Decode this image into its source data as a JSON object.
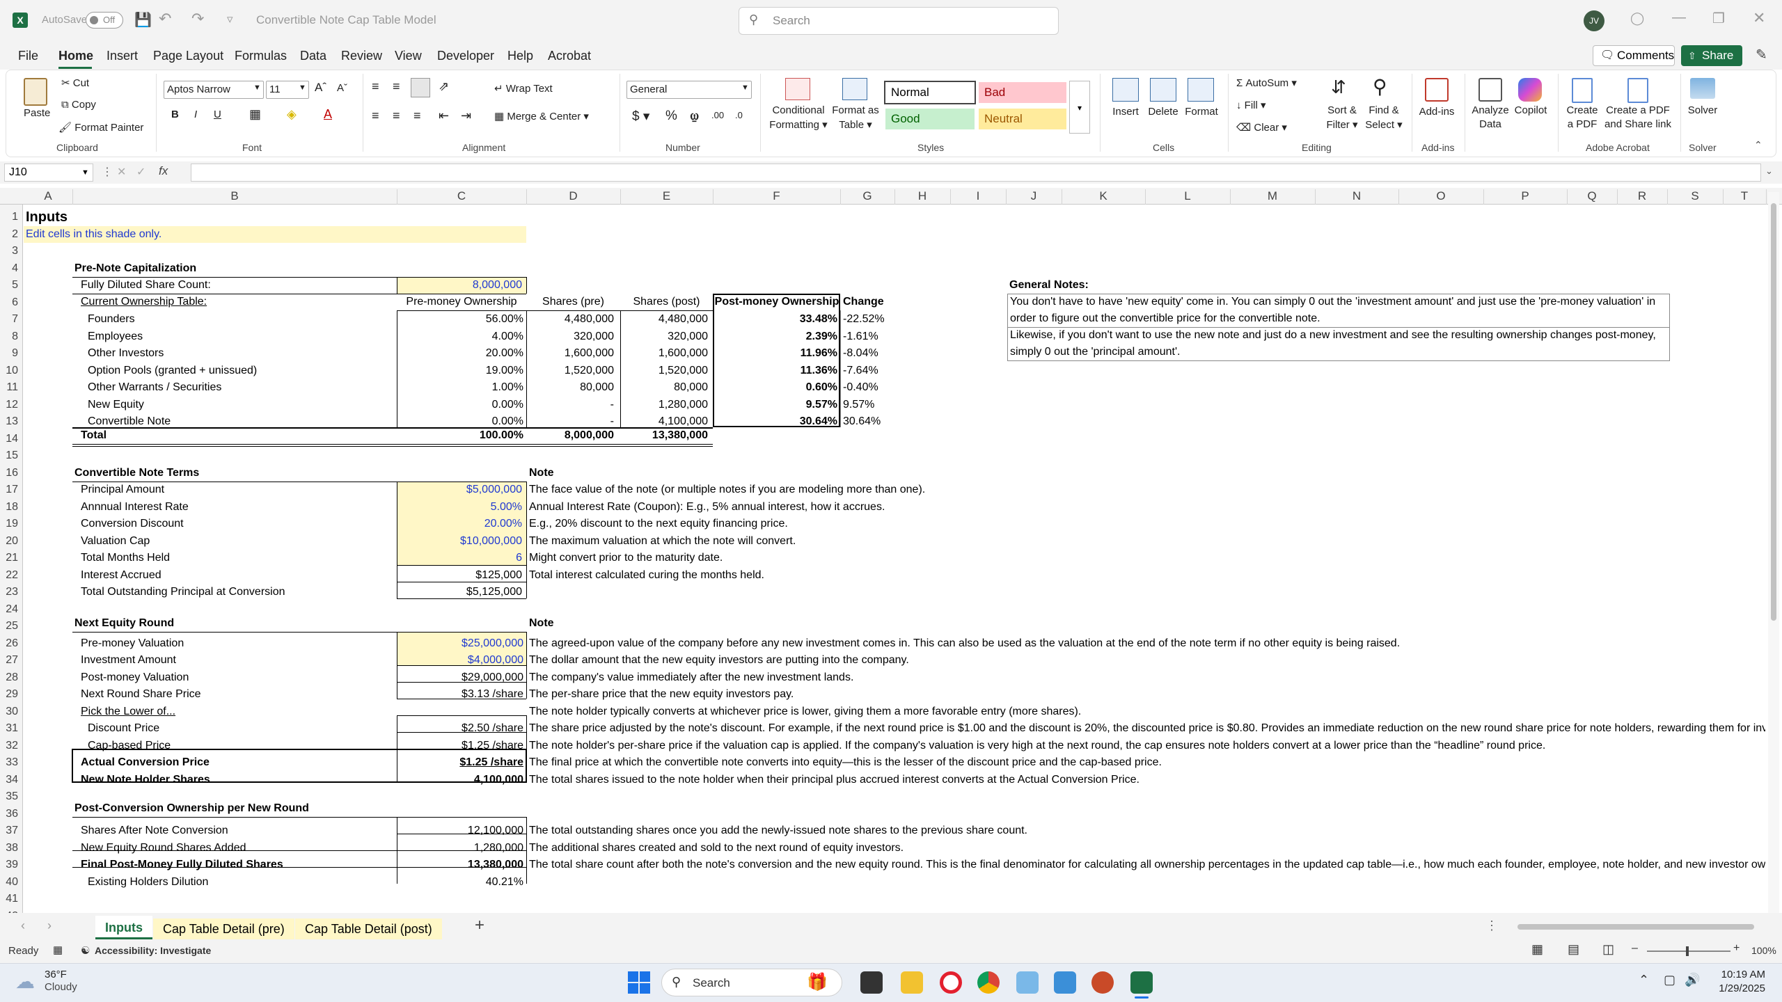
{
  "titlebar": {
    "autosave": "AutoSave",
    "autosave_state": "Off",
    "doc_title": "Convertible Note Cap Table Model",
    "search_placeholder": "Search",
    "avatar": "JV"
  },
  "menu": [
    "File",
    "Home",
    "Insert",
    "Page Layout",
    "Formulas",
    "Data",
    "Review",
    "View",
    "Developer",
    "Help",
    "Acrobat"
  ],
  "actions": {
    "comments": "Comments",
    "share": "Share"
  },
  "ribbon": {
    "clipboard": {
      "paste": "Paste",
      "cut": "Cut",
      "copy": "Copy",
      "format_painter": "Format Painter",
      "label": "Clipboard"
    },
    "font": {
      "name": "Aptos Narrow",
      "size": "11",
      "label": "Font"
    },
    "alignment": {
      "wrap": "Wrap Text",
      "merge": "Merge & Center",
      "label": "Alignment"
    },
    "number": {
      "format": "General",
      "label": "Number"
    },
    "styles": {
      "conditional": "Conditional",
      "conditional2": "Formatting",
      "format_table": "Format as",
      "format_table2": "Table",
      "normal": "Normal",
      "bad": "Bad",
      "good": "Good",
      "neutral": "Neutral",
      "label": "Styles"
    },
    "cells": {
      "insert": "Insert",
      "delete": "Delete",
      "format": "Format",
      "label": "Cells"
    },
    "editing": {
      "autosum": "AutoSum",
      "fill": "Fill",
      "clear": "Clear",
      "sort": "Sort &",
      "sort2": "Filter",
      "find": "Find &",
      "find2": "Select",
      "label": "Editing"
    },
    "addins": {
      "addins": "Add-ins",
      "label": "Add-ins",
      "analyze": "Analyze",
      "analyze2": "Data",
      "copilot": "Copilot"
    },
    "acrobat": {
      "create": "Create",
      "create2": "a PDF",
      "create_share": "Create a PDF",
      "create_share2": "and Share link",
      "label": "Adobe Acrobat"
    },
    "solver": {
      "solver": "Solver",
      "label": "Solver"
    }
  },
  "formula_bar": {
    "namebox": "J10",
    "fx": "fx",
    "formula": ""
  },
  "columns": [
    "A",
    "B",
    "C",
    "D",
    "E",
    "F",
    "G",
    "H",
    "I",
    "J",
    "K",
    "L",
    "M",
    "N",
    "O",
    "P",
    "Q",
    "R",
    "S",
    "T"
  ],
  "rows": [
    "1",
    "2",
    "3",
    "4",
    "5",
    "6",
    "7",
    "8",
    "9",
    "10",
    "11",
    "12",
    "13",
    "14",
    "15",
    "16",
    "17",
    "18",
    "19",
    "20",
    "21",
    "22",
    "23",
    "24",
    "25",
    "26",
    "27",
    "28",
    "29",
    "30",
    "31",
    "32",
    "33",
    "34",
    "35",
    "36",
    "37",
    "38",
    "39",
    "40",
    "41",
    "42"
  ],
  "sheet": {
    "title": "Inputs",
    "instruction": "Edit cells in this shade only.",
    "pre_note": {
      "header": "Pre-Note Capitalization",
      "fd_label": "Fully Diluted Share Count:",
      "fd_value": "8,000,000",
      "table_label": "Current Ownership Table:",
      "col_pre": "Pre-money Ownership",
      "col_shares_pre": "Shares (pre)",
      "col_shares_post": "Shares (post)",
      "col_post": "Post-money Ownership",
      "col_change": "Change",
      "rows": [
        {
          "name": "Founders",
          "pre": "56.00%",
          "sp": "4,480,000",
          "spo": "4,480,000",
          "post": "33.48%",
          "chg": "-22.52%"
        },
        {
          "name": "Employees",
          "pre": "4.00%",
          "sp": "320,000",
          "spo": "320,000",
          "post": "2.39%",
          "chg": "-1.61%"
        },
        {
          "name": "Other Investors",
          "pre": "20.00%",
          "sp": "1,600,000",
          "spo": "1,600,000",
          "post": "11.96%",
          "chg": "-8.04%"
        },
        {
          "name": "Option Pools (granted + unissued)",
          "pre": "19.00%",
          "sp": "1,520,000",
          "spo": "1,520,000",
          "post": "11.36%",
          "chg": "-7.64%"
        },
        {
          "name": "Other Warrants / Securities",
          "pre": "1.00%",
          "sp": "80,000",
          "spo": "80,000",
          "post": "0.60%",
          "chg": "-0.40%"
        },
        {
          "name": "New Equity",
          "pre": "0.00%",
          "sp": "-",
          "spo": "1,280,000",
          "post": "9.57%",
          "chg": "9.57%"
        },
        {
          "name": "Convertible Note",
          "pre": "0.00%",
          "sp": "-",
          "spo": "4,100,000",
          "post": "30.64%",
          "chg": "30.64%"
        }
      ],
      "total": {
        "name": "Total",
        "pre": "100.00%",
        "sp": "8,000,000",
        "spo": "13,380,000"
      }
    },
    "general_notes": {
      "header": "General Notes:",
      "l1": "You don't have to have 'new equity' come in. You can simply 0 out the 'investment amount' and just use the 'pre-money valuation' in",
      "l2": "order to figure out the convertible price for the convertible note.",
      "l3": "Likewise, if you don't want to use the new note and just do a new investment and see the resulting ownership changes post-money,",
      "l4": "simply 0 out the 'principal amount'."
    },
    "note_terms": {
      "header": "Convertible Note Terms",
      "note_header": "Note",
      "rows": [
        {
          "label": "Principal Amount",
          "value": "$5,000,000",
          "note": "The face value of the note (or multiple notes if you are modeling more than one)."
        },
        {
          "label": "Annnual Interest Rate",
          "value": "5.00%",
          "note": "Annual Interest Rate (Coupon): E.g., 5% annual interest, how it accrues."
        },
        {
          "label": "Conversion Discount",
          "value": "20.00%",
          "note": "E.g., 20% discount to the next equity financing price."
        },
        {
          "label": "Valuation Cap",
          "value": "$10,000,000",
          "note": "The maximum valuation at which the note will convert."
        },
        {
          "label": "Total Months Held",
          "value": "6",
          "note": "Might convert prior to the maturity date."
        },
        {
          "label": "Interest Accrued",
          "value": "$125,000",
          "note": "Total interest calculated curing the months held."
        },
        {
          "label": "Total Outstanding Principal at Conversion",
          "value": "$5,125,000",
          "note": ""
        }
      ]
    },
    "equity_round": {
      "header": "Next Equity Round",
      "note_header": "Note",
      "rows": [
        {
          "label": "Pre-money Valuation",
          "value": "$25,000,000",
          "note": "The agreed-upon value of the company before any new investment comes in. This can also be used as the valuation at the end of the note term if no other equity is being raised."
        },
        {
          "label": "Investment Amount",
          "value": "$4,000,000",
          "note": "The dollar amount that the new equity investors are putting into the company."
        },
        {
          "label": "Post-money Valuation",
          "value": "$29,000,000",
          "note": "The company's value immediately after the new investment lands."
        },
        {
          "label": "Next Round Share Price",
          "value": "$3.13 /share",
          "note": "The per-share price that the new equity investors pay."
        },
        {
          "label": "Pick the Lower of...",
          "value": "",
          "note": "The note holder typically converts at whichever price is lower, giving them a more favorable entry (more shares)."
        },
        {
          "label": "Discount Price",
          "value": "$2.50 /share",
          "note": "The share price adjusted by the note's discount. For example, if the next round price is $1.00 and the discount is 20%, the discounted price is $0.80. Provides an immediate reduction on the new round share price for note holders, rewarding them for inve"
        },
        {
          "label": "Cap-based Price",
          "value": "$1.25 /share",
          "note": "The note holder's per-share price if the valuation cap is applied. If the company's valuation is very high at the next round, the cap ensures note holders convert at a lower price than the “headline” round price."
        },
        {
          "label": "Actual Conversion Price",
          "value": "$1.25 /share",
          "note": "The final price at which the convertible note converts into equity—this is the lesser of the discount price and the cap-based price."
        },
        {
          "label": "New Note Holder Shares",
          "value": "4,100,000",
          "note": "The total shares issued to the note holder when their principal plus accrued interest converts at the Actual Conversion Price."
        }
      ]
    },
    "post_conv": {
      "header": "Post-Conversion Ownership per New Round",
      "rows": [
        {
          "label": "Shares After Note Conversion",
          "value": "12,100,000",
          "note": "The total outstanding shares once you add the newly-issued note shares to the previous share count."
        },
        {
          "label": "New Equity Round Shares Added",
          "value": "1,280,000",
          "note": "The additional shares created and sold to the next round of equity investors."
        },
        {
          "label": "Final Post-Money Fully Diluted Shares",
          "value": "13,380,000",
          "note": "The total share count after both the note's conversion and the new equity round. This is the final denominator for calculating all ownership percentages in the updated cap table—i.e., how much each founder, employee, note holder, and new investor own"
        },
        {
          "label": "Existing Holders Dilution",
          "value": "40.21%",
          "note": ""
        }
      ]
    }
  },
  "tabs": [
    "Inputs",
    "Cap Table Detail (pre)",
    "Cap Table Detail (post)"
  ],
  "status": {
    "ready": "Ready",
    "accessibility": "Accessibility: Investigate",
    "zoom": "100%"
  },
  "taskbar": {
    "temp": "36°F",
    "weather": "Cloudy",
    "search": "Search",
    "time": "10:19 AM",
    "date": "1/29/2025"
  }
}
